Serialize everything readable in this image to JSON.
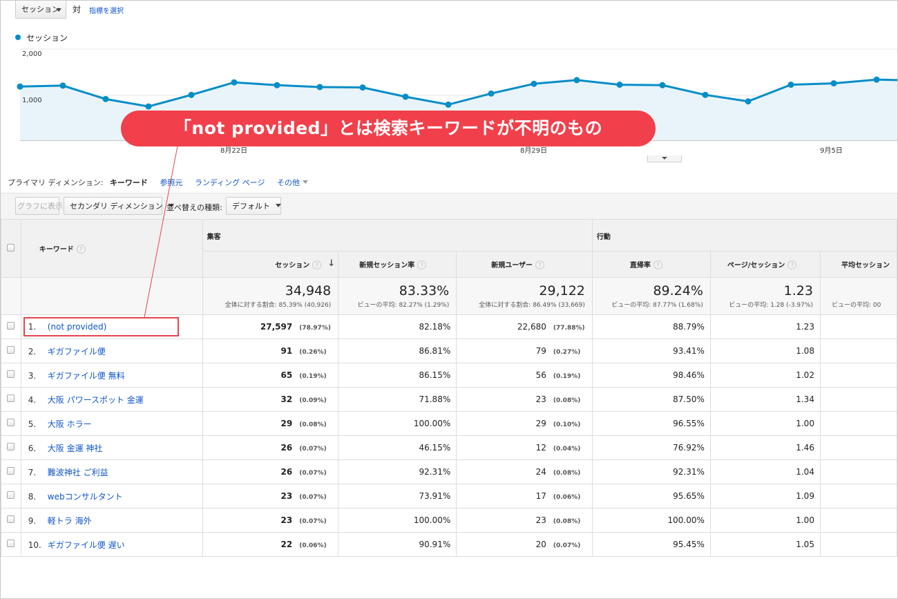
{
  "header": {
    "metric_selected": "セッション",
    "vs_label": "対",
    "pick_metric_link": "指標を選択"
  },
  "chart_data": {
    "type": "line",
    "series": [
      {
        "name": "セッション",
        "values": [
          1190,
          1210,
          920,
          760,
          1010,
          1280,
          1220,
          1180,
          1170,
          970,
          800,
          1040,
          1250,
          1330,
          1230,
          1220,
          1010,
          870,
          1230,
          1260,
          1340,
          1320
        ]
      }
    ],
    "ylim": [
      0,
      2000
    ],
    "yticks": [
      "2,000",
      "1,000"
    ],
    "xticks": [
      {
        "label": "8月22日",
        "index": 5
      },
      {
        "label": "8月29日",
        "index": 12
      },
      {
        "label": "9月5日",
        "index": 19
      }
    ],
    "color": "#058dc7",
    "fill": "#e9f4fa"
  },
  "callout": {
    "text": "「not provided」とは検索キーワードが不明のもの",
    "color": "#f1404b"
  },
  "dimension": {
    "label": "プライマリ ディメンション:",
    "tabs": [
      "キーワード",
      "参照元",
      "ランディング ページ",
      "その他"
    ]
  },
  "toolbar": {
    "graph_button": "グラフに表示",
    "secondary_dimension": "セカンダリ ディメンション",
    "sort_label": "並べ替えの種類:",
    "sort_value": "デフォルト"
  },
  "table": {
    "keyword_header": "キーワード",
    "groups": [
      "集客",
      "行動"
    ],
    "columns": [
      "セッション",
      "新規セッション率",
      "新規ユーザー",
      "直帰率",
      "ページ/セッション",
      "平均セッション"
    ],
    "totals": [
      {
        "value": "34,948",
        "sub": "全体に対する割合: 85.39% (40,926)"
      },
      {
        "value": "83.33%",
        "sub": "ビューの平均: 82.27% (1.29%)"
      },
      {
        "value": "29,122",
        "sub": "全体に対する割合: 86.49% (33,669)"
      },
      {
        "value": "89.24%",
        "sub": "ビューの平均: 87.77% (1.68%)"
      },
      {
        "value": "1.23",
        "sub": "ビューの平均: 1.28 (-3.97%)"
      },
      {
        "value": "",
        "sub": "ビューの平均: 00"
      }
    ],
    "rows": [
      {
        "n": "1.",
        "kw": "(not provided)",
        "s": "27,597",
        "sp": "(78.97%)",
        "nsr": "82.18%",
        "nu": "22,680",
        "nup": "(77.88%)",
        "br": "88.79%",
        "pps": "1.23"
      },
      {
        "n": "2.",
        "kw": "ギガファイル便",
        "s": "91",
        "sp": "(0.26%)",
        "nsr": "86.81%",
        "nu": "79",
        "nup": "(0.27%)",
        "br": "93.41%",
        "pps": "1.08"
      },
      {
        "n": "3.",
        "kw": "ギガファイル便 無料",
        "s": "65",
        "sp": "(0.19%)",
        "nsr": "86.15%",
        "nu": "56",
        "nup": "(0.19%)",
        "br": "98.46%",
        "pps": "1.02"
      },
      {
        "n": "4.",
        "kw": "大阪 パワースポット 金運",
        "s": "32",
        "sp": "(0.09%)",
        "nsr": "71.88%",
        "nu": "23",
        "nup": "(0.08%)",
        "br": "87.50%",
        "pps": "1.34"
      },
      {
        "n": "5.",
        "kw": "大阪 ホラー",
        "s": "29",
        "sp": "(0.08%)",
        "nsr": "100.00%",
        "nu": "29",
        "nup": "(0.10%)",
        "br": "96.55%",
        "pps": "1.00"
      },
      {
        "n": "6.",
        "kw": "大阪 金運 神社",
        "s": "26",
        "sp": "(0.07%)",
        "nsr": "46.15%",
        "nu": "12",
        "nup": "(0.04%)",
        "br": "76.92%",
        "pps": "1.46"
      },
      {
        "n": "7.",
        "kw": "難波神社 ご利益",
        "s": "26",
        "sp": "(0.07%)",
        "nsr": "92.31%",
        "nu": "24",
        "nup": "(0.08%)",
        "br": "92.31%",
        "pps": "1.04"
      },
      {
        "n": "8.",
        "kw": "webコンサルタント",
        "s": "23",
        "sp": "(0.07%)",
        "nsr": "73.91%",
        "nu": "17",
        "nup": "(0.06%)",
        "br": "95.65%",
        "pps": "1.09"
      },
      {
        "n": "9.",
        "kw": "軽トラ 海外",
        "s": "23",
        "sp": "(0.07%)",
        "nsr": "100.00%",
        "nu": "23",
        "nup": "(0.08%)",
        "br": "100.00%",
        "pps": "1.00"
      },
      {
        "n": "10.",
        "kw": "ギガファイル便 遅い",
        "s": "22",
        "sp": "(0.06%)",
        "nsr": "90.91%",
        "nu": "20",
        "nup": "(0.07%)",
        "br": "95.45%",
        "pps": "1.05"
      }
    ]
  }
}
